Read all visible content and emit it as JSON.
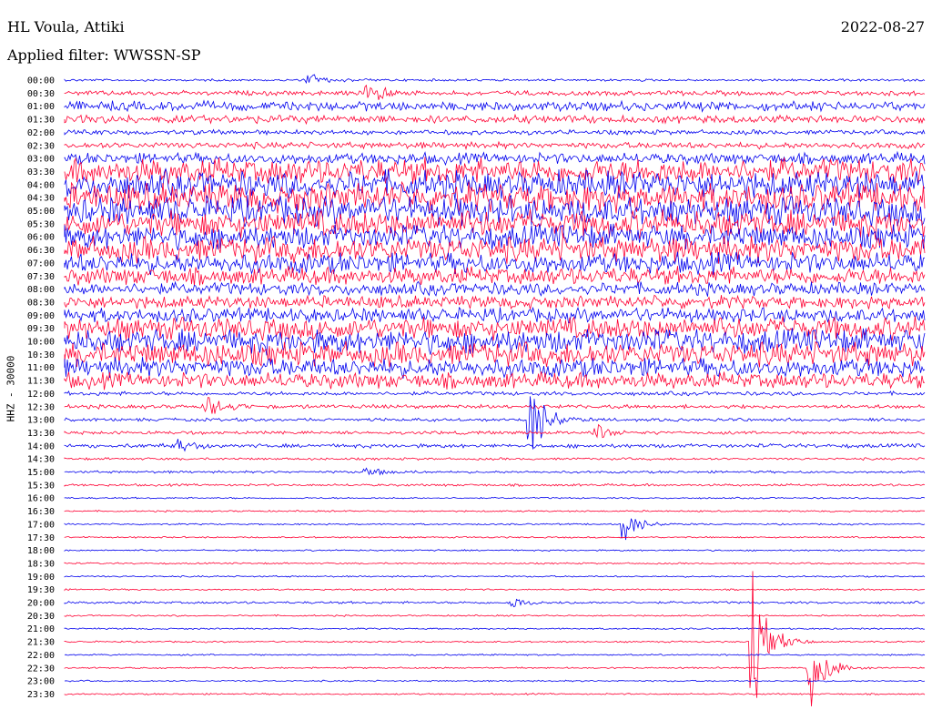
{
  "header": {
    "station": "HL Voula, Attiki",
    "date": "2022-08-27",
    "filter": "Applied filter: WWSSN-SP"
  },
  "chart_data": {
    "type": "helicorder",
    "ylabel": "HHZ - 30000",
    "colors": [
      "#0000ee",
      "#ff0033"
    ],
    "row_labels": [
      "00:00",
      "00:30",
      "01:00",
      "01:30",
      "02:00",
      "02:30",
      "03:00",
      "03:30",
      "04:00",
      "04:30",
      "05:00",
      "05:30",
      "06:00",
      "06:30",
      "07:00",
      "07:30",
      "08:00",
      "08:30",
      "09:00",
      "09:30",
      "10:00",
      "10:30",
      "11:00",
      "11:30",
      "12:00",
      "12:30",
      "13:00",
      "13:30",
      "14:00",
      "14:30",
      "15:00",
      "15:30",
      "16:00",
      "16:30",
      "17:00",
      "17:30",
      "18:00",
      "18:30",
      "19:00",
      "19:30",
      "20:00",
      "20:30",
      "21:00",
      "21:30",
      "22:00",
      "22:30",
      "23:00",
      "23:30"
    ],
    "amplitude_per_row": [
      0.3,
      0.6,
      1.2,
      1.0,
      0.6,
      0.8,
      1.4,
      3.2,
      3.4,
      3.6,
      3.6,
      3.4,
      3.0,
      3.2,
      2.6,
      2.2,
      1.6,
      1.6,
      1.8,
      2.8,
      3.0,
      3.0,
      2.4,
      2.0,
      0.5,
      0.5,
      0.4,
      0.4,
      0.5,
      0.3,
      0.3,
      0.3,
      0.2,
      0.2,
      0.2,
      0.2,
      0.2,
      0.2,
      0.2,
      0.2,
      0.3,
      0.2,
      0.2,
      0.2,
      0.2,
      0.2,
      0.2,
      0.2
    ],
    "events": [
      {
        "row": 0,
        "minute": 8.5,
        "amp": 1.2
      },
      {
        "row": 1,
        "minute": 10.5,
        "amp": 2.0
      },
      {
        "row": 25,
        "minute": 5.0,
        "amp": 2.0
      },
      {
        "row": 26,
        "minute": 16.2,
        "amp": 8.0
      },
      {
        "row": 27,
        "minute": 18.5,
        "amp": 1.4
      },
      {
        "row": 28,
        "minute": 4.0,
        "amp": 1.2
      },
      {
        "row": 30,
        "minute": 10.5,
        "amp": 1.0
      },
      {
        "row": 34,
        "minute": 19.5,
        "amp": 3.0
      },
      {
        "row": 40,
        "minute": 15.5,
        "amp": 1.2
      },
      {
        "row": 43,
        "minute": 24.0,
        "amp": 11.0
      },
      {
        "row": 45,
        "minute": 26.0,
        "amp": 7.0
      }
    ]
  }
}
